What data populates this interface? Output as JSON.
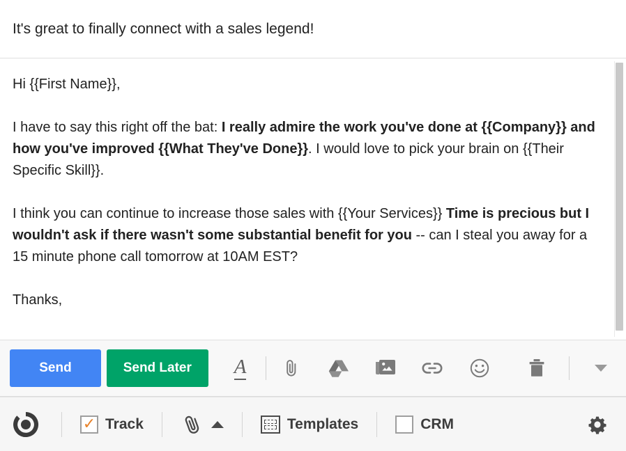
{
  "subject": {
    "text": "It's great to finally connect with a sales legend!"
  },
  "body": {
    "paragraphs": [
      {
        "id": "greeting",
        "runs": [
          {
            "text": "Hi {{First Name}},",
            "bold": false
          }
        ]
      },
      {
        "id": "paragraph-1",
        "runs": [
          {
            "text": "I have to say this right off the bat: ",
            "bold": false
          },
          {
            "text": "I really admire the work you've done at {{Company}} and how you've improved {{What They've Done}}",
            "bold": true
          },
          {
            "text": ". I would love to pick your brain on {{Their Specific Skill}}.",
            "bold": false
          }
        ]
      },
      {
        "id": "paragraph-2",
        "runs": [
          {
            "text": "I think you can continue to increase those sales with {{Your Services}} ",
            "bold": false
          },
          {
            "text": "Time is precious but I wouldn't ask if there wasn't some substantial benefit for you",
            "bold": true
          },
          {
            "text": " -- can I steal you away for a 15 minute phone call tomorrow at 10AM EST?",
            "bold": false
          }
        ]
      },
      {
        "id": "signoff",
        "runs": [
          {
            "text": "Thanks,",
            "bold": false
          }
        ]
      }
    ]
  },
  "toolbar": {
    "send_label": "Send",
    "send_later_label": "Send Later",
    "send_color": "#4285f4",
    "send_later_color": "#00a368",
    "icons": [
      {
        "name": "format-text-icon",
        "glyph": "A"
      },
      {
        "name": "attach-file-icon",
        "glyph": "paperclip"
      },
      {
        "name": "google-drive-icon",
        "glyph": "drive"
      },
      {
        "name": "insert-photo-icon",
        "glyph": "photo"
      },
      {
        "name": "insert-link-icon",
        "glyph": "link"
      },
      {
        "name": "insert-emoji-icon",
        "glyph": "emoji"
      },
      {
        "name": "discard-draft-icon",
        "glyph": "trash"
      },
      {
        "name": "more-options-icon",
        "glyph": "chevron-down"
      }
    ]
  },
  "yesware_bar": {
    "logo_name": "yesware-logo",
    "track_label": "Track",
    "track_checked": true,
    "track_check_color": "#e8822a",
    "templates_label": "Templates",
    "crm_label": "CRM",
    "crm_checked": false,
    "settings_name": "settings-gear-icon"
  }
}
